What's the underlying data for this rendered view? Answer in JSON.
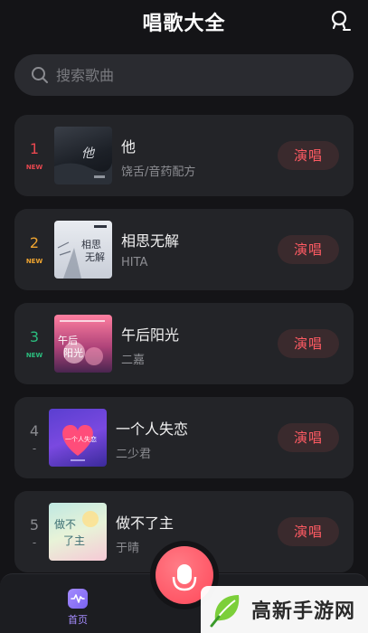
{
  "app": {
    "title": "唱歌大全"
  },
  "search": {
    "placeholder": "搜索歌曲"
  },
  "songs": [
    {
      "rank": "1",
      "tag": "NEW",
      "tag_color": "#e8474f",
      "title": "他",
      "singer": "饶舌/音药配方",
      "button": "演唱",
      "cover_text": "他"
    },
    {
      "rank": "2",
      "tag": "NEW",
      "tag_color": "#f0a530",
      "title": "相思无解",
      "singer": "HITA",
      "button": "演唱",
      "cover_text": "相思无解"
    },
    {
      "rank": "3",
      "tag": "NEW",
      "tag_color": "#2bbd7e",
      "title": "午后阳光",
      "singer": "二嘉",
      "button": "演唱",
      "cover_text": "午后阳光"
    },
    {
      "rank": "4",
      "tag": "-",
      "tag_color": "#8a8b90",
      "title": "一个人失恋",
      "singer": "二少君",
      "button": "演唱",
      "cover_text": "一个人失恋"
    },
    {
      "rank": "5",
      "tag": "-",
      "tag_color": "#8a8b90",
      "title": "做不了主",
      "singer": "于晴",
      "button": "演唱",
      "cover_text": "做不了主"
    }
  ],
  "tabbar": {
    "home_label": "首页"
  },
  "watermark": {
    "text": "高新手游网"
  },
  "colors": {
    "accent": "#ff5b63",
    "tab_active": "#a58cff",
    "background": "#141417",
    "card": "#232428"
  }
}
